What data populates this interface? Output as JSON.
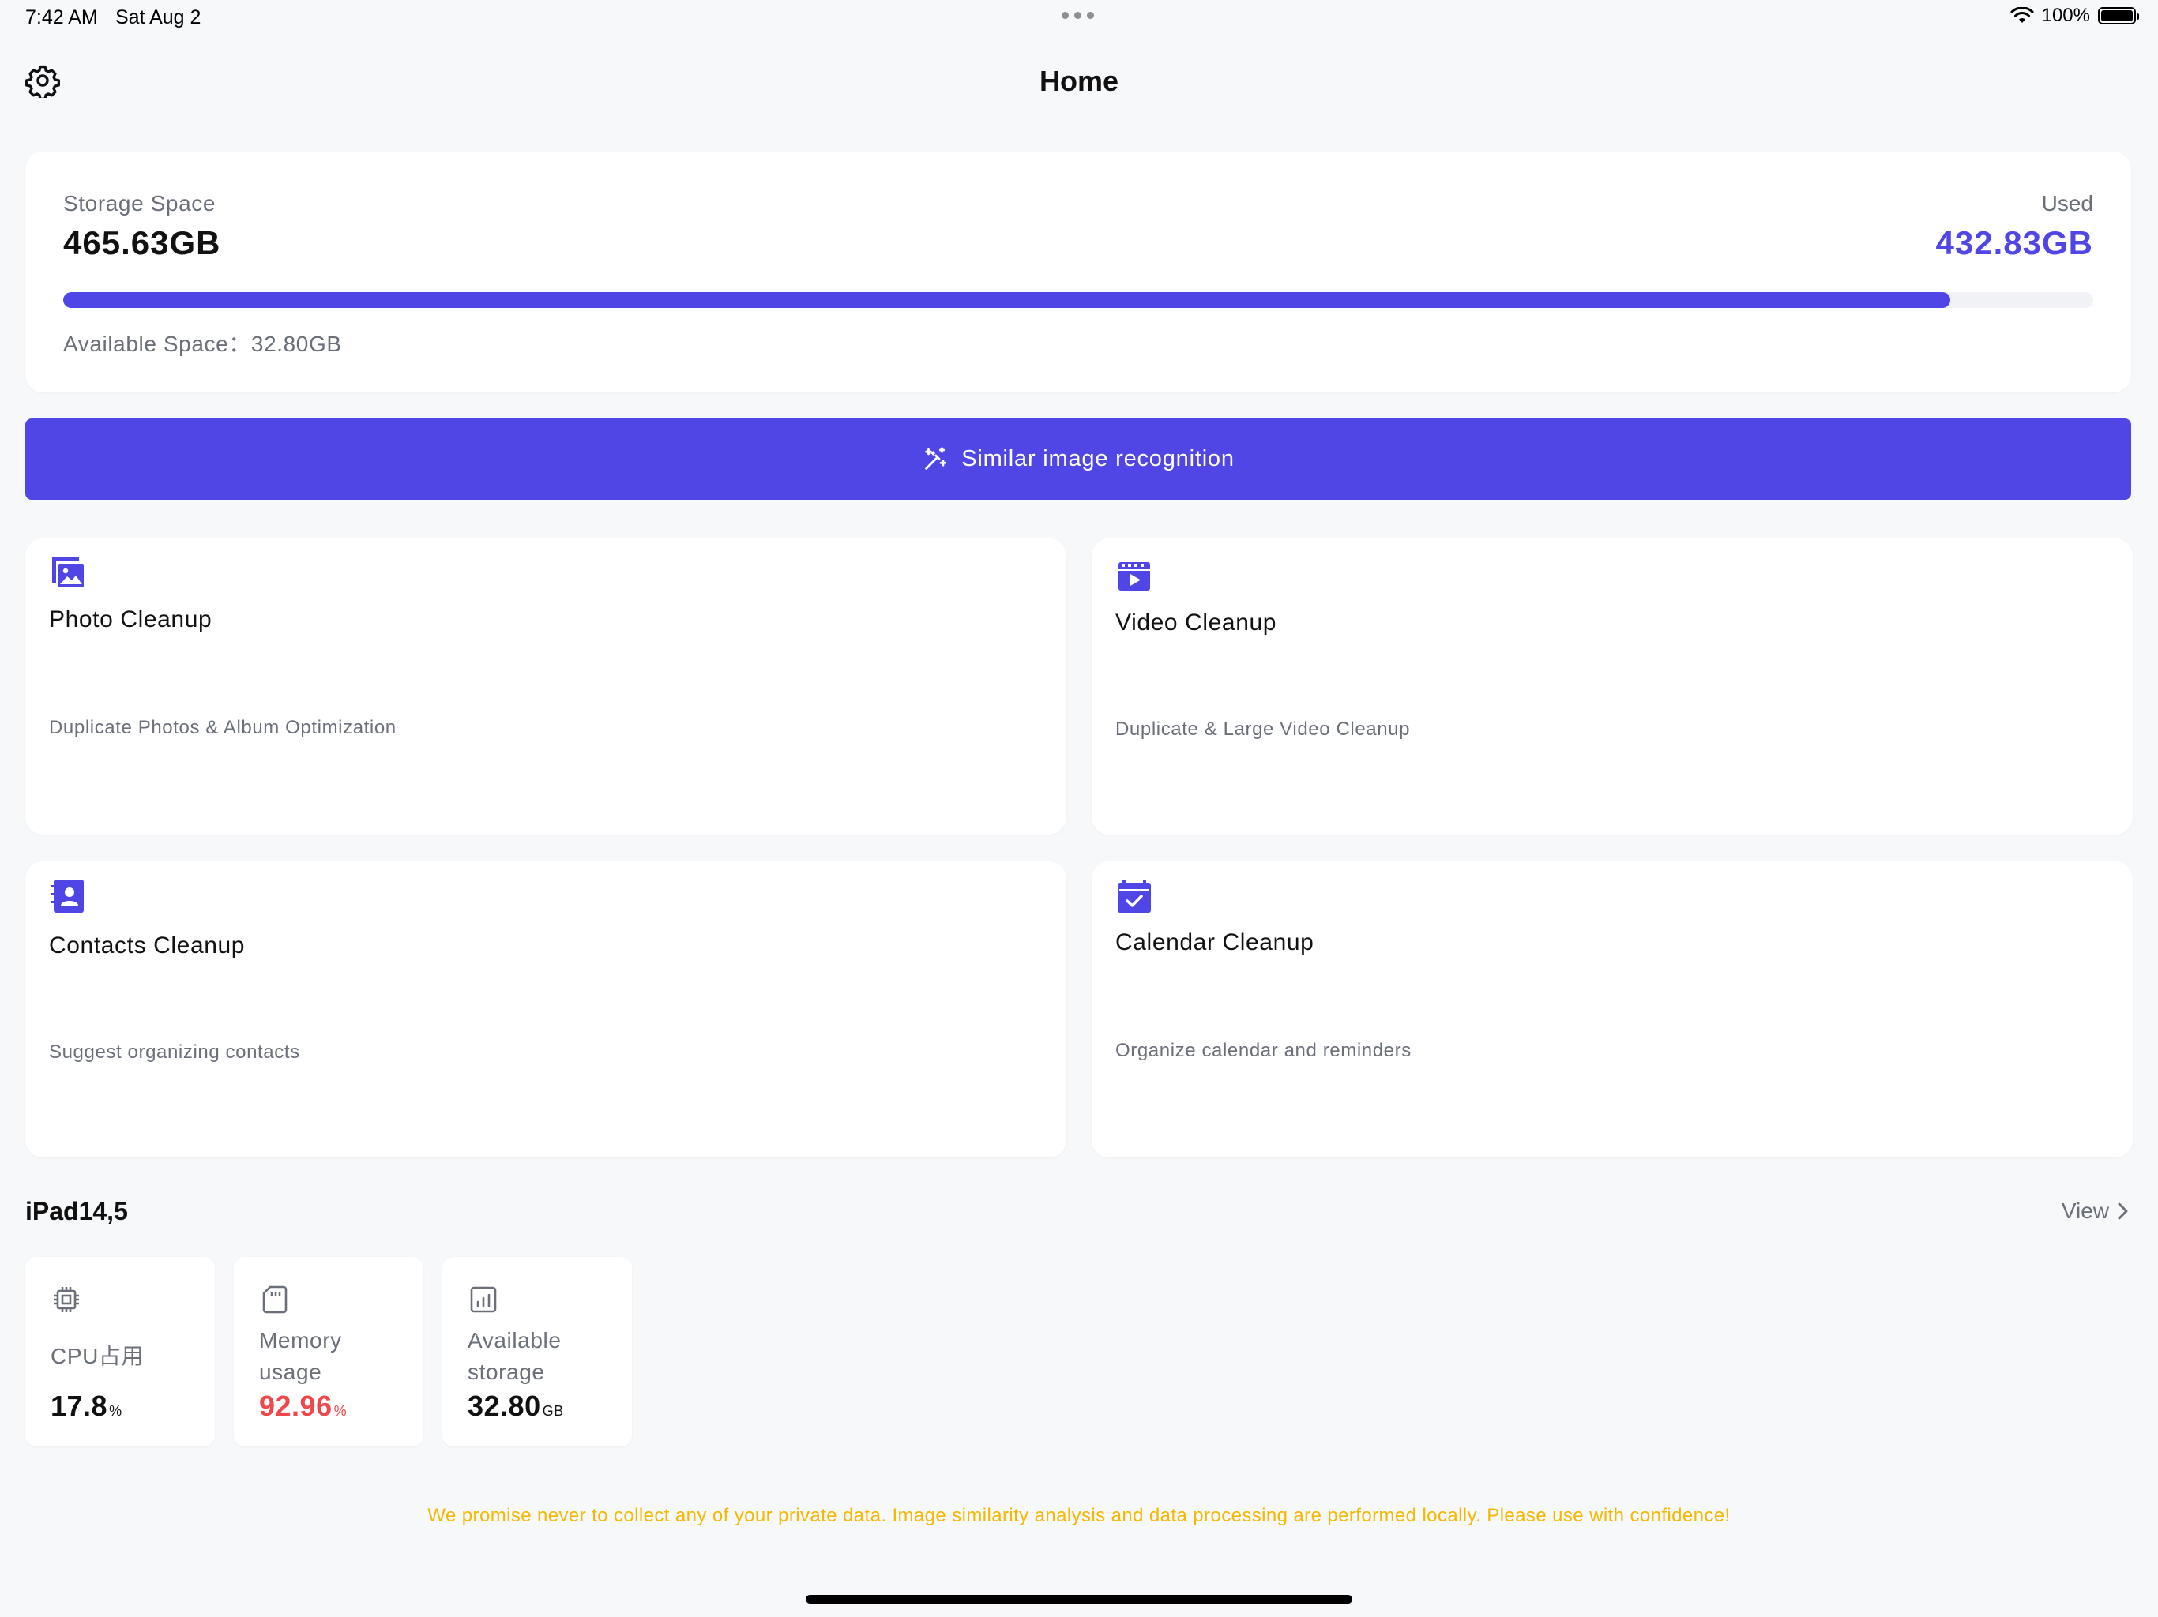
{
  "status_bar": {
    "time": "7:42 AM",
    "date": "Sat Aug 2",
    "battery": "100%"
  },
  "header": {
    "title": "Home",
    "settings_icon": "gear-icon"
  },
  "storage": {
    "label": "Storage Space",
    "total": "465.63GB",
    "used_label": "Used",
    "used": "432.83GB",
    "used_fraction": 0.9296,
    "available": "Available Space：32.80GB",
    "accent_color": "#5046e5"
  },
  "primary_action": {
    "label": "Similar image recognition",
    "icon": "magic-wand-icon"
  },
  "features": [
    {
      "title": "Photo Cleanup",
      "desc": "Duplicate Photos & Album Optimization",
      "icon": "photo-icon"
    },
    {
      "title": "Video Cleanup",
      "desc": "Duplicate & Large Video Cleanup",
      "icon": "video-icon"
    },
    {
      "title": "Contacts Cleanup",
      "desc": "Suggest organizing contacts",
      "icon": "contacts-icon"
    },
    {
      "title": "Calendar Cleanup",
      "desc": "Organize calendar and reminders",
      "icon": "calendar-icon"
    }
  ],
  "device": {
    "name": "iPad14,5",
    "view_label": "View",
    "stats": [
      {
        "label": "CPU占用",
        "value": "17.8",
        "unit": "%",
        "icon": "cpu-icon"
      },
      {
        "label_line1": "Memory",
        "label_line2": "usage",
        "value": "92.96",
        "unit": "%",
        "icon": "sd-card-icon",
        "value_color": "#f0474a"
      },
      {
        "label_line1": "Available",
        "label_line2": "storage",
        "value": "32.80",
        "unit": "GB",
        "icon": "chart-icon"
      }
    ]
  },
  "privacy_note": "We promise never to collect any of your private data. Image similarity analysis and data processing are performed locally. Please use with confidence!"
}
